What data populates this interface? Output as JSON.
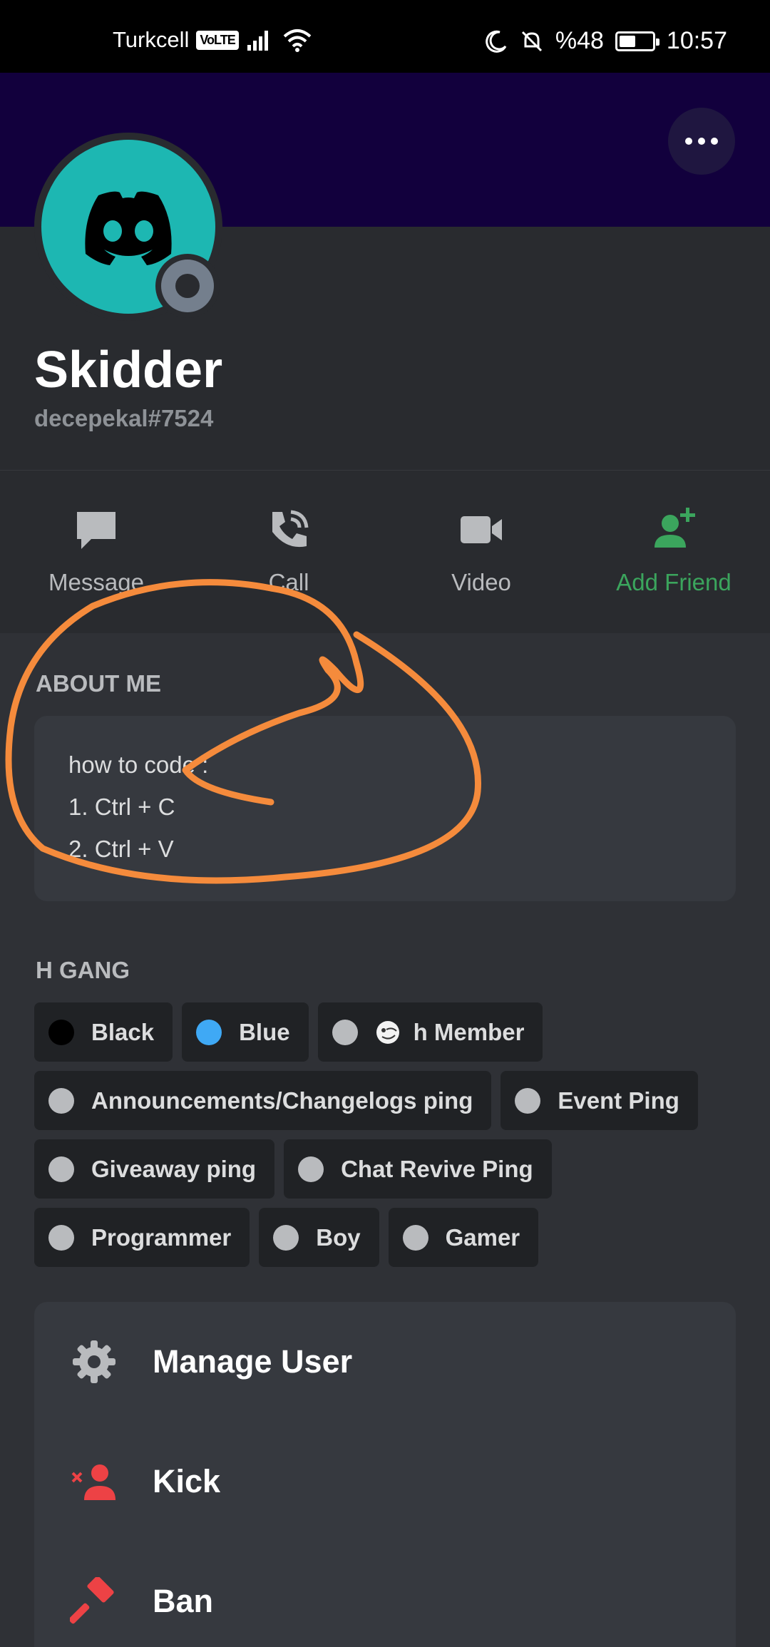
{
  "status_bar": {
    "carrier": "Turkcell",
    "volte": "VoLTE",
    "battery": "%48",
    "time": "10:57"
  },
  "profile": {
    "name": "Skidder",
    "tag": "decepekal#7524"
  },
  "actions": [
    {
      "label": "Message",
      "icon": "message-icon"
    },
    {
      "label": "Call",
      "icon": "phone-icon"
    },
    {
      "label": "Video",
      "icon": "video-icon"
    },
    {
      "label": "Add Friend",
      "icon": "add-friend-icon"
    }
  ],
  "about": {
    "title": "ABOUT ME",
    "lines": [
      "how to code :",
      "1. Ctrl + C",
      "2. Ctrl + V"
    ]
  },
  "roles_section": {
    "title": "H GANG",
    "roles": [
      {
        "label": "Black",
        "color": "#000000"
      },
      {
        "label": "Blue",
        "color": "#3fa9f5"
      },
      {
        "label": "h Member",
        "color": "#b9bbbe"
      },
      {
        "label": "Announcements/Changelogs ping",
        "color": "#b9bbbe"
      },
      {
        "label": "Event Ping",
        "color": "#b9bbbe"
      },
      {
        "label": "Giveaway ping",
        "color": "#b9bbbe"
      },
      {
        "label": "Chat Revive Ping",
        "color": "#b9bbbe"
      },
      {
        "label": "Programmer",
        "color": "#b9bbbe"
      },
      {
        "label": "Boy",
        "color": "#b9bbbe"
      },
      {
        "label": "Gamer",
        "color": "#b9bbbe"
      }
    ]
  },
  "management": [
    {
      "label": "Manage User",
      "icon": "gear-icon"
    },
    {
      "label": "Kick",
      "icon": "kick-icon"
    },
    {
      "label": "Ban",
      "icon": "ban-hammer-icon"
    }
  ],
  "colors": {
    "banner": "#12003d",
    "avatar": "#1db7b2",
    "green": "#3ba55d",
    "danger": "#ed4245",
    "scribble": "#f58b3c"
  }
}
